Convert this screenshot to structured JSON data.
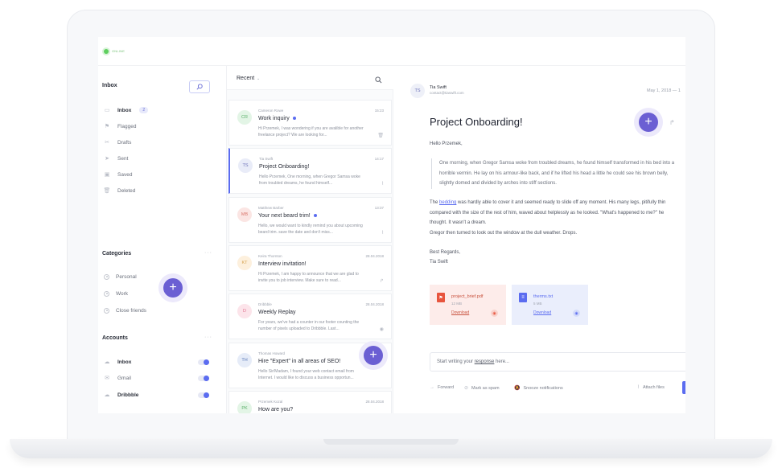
{
  "status": {
    "label": "ONLINE"
  },
  "sidebar": {
    "title": "Inbox",
    "nav": [
      {
        "label": "Inbox",
        "badge": "2"
      },
      {
        "label": "Flagged"
      },
      {
        "label": "Drafts"
      },
      {
        "label": "Sent"
      },
      {
        "label": "Saved"
      },
      {
        "label": "Deleted"
      }
    ],
    "categories_title": "Categories",
    "categories": [
      "Personal",
      "Work",
      "Close friends"
    ],
    "accounts_title": "Accounts",
    "accounts": [
      "Inbox",
      "Gmail",
      "Dribbble"
    ],
    "more": "···",
    "fab": "+"
  },
  "list": {
    "title": "Recent",
    "messages": [
      {
        "initials": "CR",
        "from": "Cameron Rowe",
        "time": "15:23",
        "subject": "Work inquiry",
        "preview": "Hi Przemek, I was wondering if you are avalible for another freelance project? We are looking for...",
        "unread": true,
        "color": "#e3f5e6",
        "text_color": "#5bb06a"
      },
      {
        "initials": "TS",
        "from": "Tia Swift",
        "time": "14:17",
        "subject": "Project Onboarding!",
        "preview": "Hello Przemek, One morning, when Gregor Samsa woke from troubled dreams, he found himself...",
        "unread": false,
        "color": "#e9ecf8",
        "text_color": "#6a6fb8"
      },
      {
        "initials": "MB",
        "from": "Matthew Barber",
        "time": "13:37",
        "subject": "Your next beard trim!",
        "preview": "Hello, we would want to kindly remind you about upcoming beard trim. save the date and don't miss...",
        "unread": true,
        "color": "#fbe5e3",
        "text_color": "#d9756b"
      },
      {
        "initials": "KT",
        "from": "Keira Thornton",
        "time": "28.04.2018",
        "subject": "Interview invitation!",
        "preview": "Hi Przemek, I am happy to announce that we are glad to invite you to job interview. Make sure to read...",
        "unread": false,
        "color": "#fdf0dd",
        "text_color": "#d6a24f"
      },
      {
        "initials": "D",
        "from": "Dribbble",
        "time": "28.04.2018",
        "subject": "Weekly Replay",
        "preview": "For years, we've had a counter in our footer counting the number of pixels uploaded to Dribbble. Last...",
        "unread": false,
        "color": "#fce4ea",
        "text_color": "#e0708e"
      },
      {
        "initials": "TH",
        "from": "Thomas Howard",
        "time": "",
        "subject": "Hire \"Expert\" in all areas of SEO!",
        "preview": "Hello Sir/Madam, I found your web contact email from Internet. I would like to discuss a business opportun...",
        "unread": false,
        "color": "#e6ecf8",
        "text_color": "#5d7bb8"
      },
      {
        "initials": "PK",
        "from": "Przemek Kozal",
        "time": "28.04.2018",
        "subject": "How are you?",
        "preview": "",
        "unread": false,
        "color": "#e3f5e6",
        "text_color": "#5bb06a"
      }
    ],
    "fab": "+"
  },
  "reader": {
    "avatar": "TS",
    "name": "Tia Swift",
    "email": "contact@tiaswift.com",
    "date": "May 1, 2018 — 1",
    "title": "Project Onboarding!",
    "greeting": "Hello Przemek,",
    "quote": "One morning, when Gregor Samsa woke from troubled dreams, he found himself transformed in his bed into a horrible vermin. He lay on his armour-like back, and if he lifted his head a little he could see his brown belly, slightly domed and divided by arches into stiff sections.",
    "body_pre": "The ",
    "body_link": "bedding",
    "body_post": " was hardly able to cover it and seemed ready to slide off any moment. His many legs, pitifully thin compared with the size of the rest of him, waved about helplessly as he looked. \"What's happened to me?\" he thought. It wasn't a dream.",
    "body_last": "Gregor then turned to look out the window at the dull weather. Drops.",
    "signoff": "Best Regards,",
    "signature": "Tia Swift",
    "attachments": [
      {
        "name": "project_brief.pdf",
        "size": "12 MB",
        "download": "Download",
        "color": "#e8553e",
        "bg": "#fdecea",
        "text": "#c9533f"
      },
      {
        "name": "therms.txt",
        "size": "5 MB",
        "download": "Download",
        "color": "#5b6cf0",
        "bg": "#eaeefc",
        "text": "#5b6cf0"
      }
    ],
    "reply_pre": "Start writing your ",
    "reply_link": "response",
    "reply_post": " here...",
    "actions": {
      "forward": "Forward",
      "spam": "Mark as spam",
      "snooze": "Snooze notifications",
      "attach": "Attach files"
    },
    "fab": "+"
  }
}
